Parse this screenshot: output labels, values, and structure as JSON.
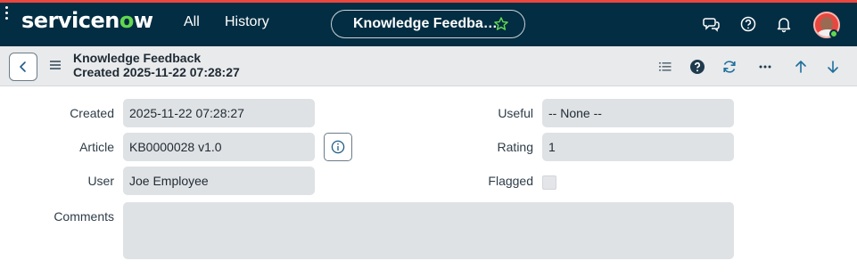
{
  "nav": {
    "logo_text_a": "servicen",
    "logo_text_o": "o",
    "logo_text_b": "w",
    "all_label": "All",
    "history_label": "History",
    "record_title": "Knowledge Feedba…"
  },
  "header": {
    "title": "Knowledge Feedback",
    "subtitle": "Created 2025-11-22 07:28:27"
  },
  "form": {
    "created": {
      "label": "Created",
      "value": "2025-11-22 07:28:27"
    },
    "article": {
      "label": "Article",
      "value": "KB0000028 v1.0"
    },
    "user": {
      "label": "User",
      "value": "Joe Employee"
    },
    "comments": {
      "label": "Comments",
      "value": ""
    },
    "useful": {
      "label": "Useful",
      "value": "-- None --"
    },
    "rating": {
      "label": "Rating",
      "value": "1"
    },
    "flagged": {
      "label": "Flagged",
      "checked": false
    }
  },
  "colors": {
    "brand_navy": "#032d42",
    "accent_green": "#62d84e",
    "top_accent_red": "#e8473f",
    "field_bg": "#dfe2e5"
  },
  "icons": [
    "star-icon",
    "chat-icon",
    "help-icon",
    "bell-icon",
    "back-icon",
    "menu-icon",
    "list-icon",
    "help-circle-icon",
    "refresh-icon",
    "more-icon",
    "arrow-up-icon",
    "arrow-down-icon",
    "info-icon"
  ]
}
